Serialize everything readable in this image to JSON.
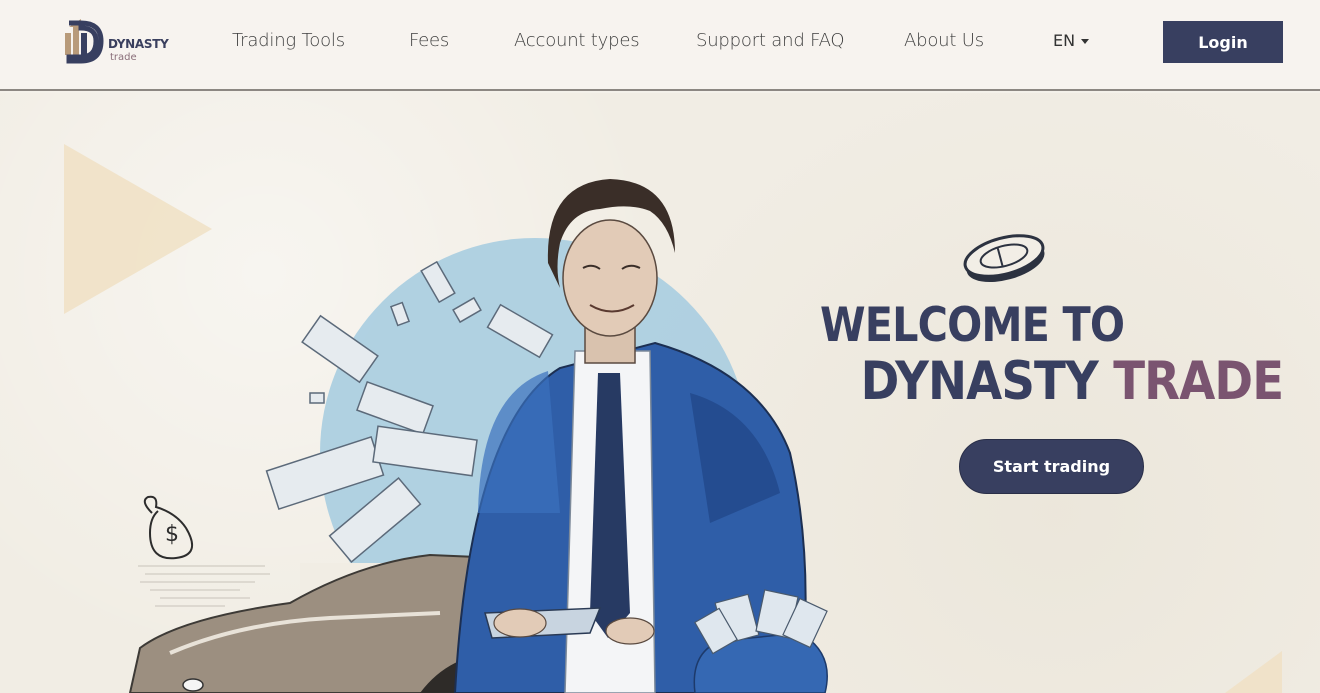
{
  "header": {
    "logo": {
      "name": "DYNASTY",
      "sub": "trade"
    },
    "nav": [
      {
        "label": "Trading Tools"
      },
      {
        "label": "Fees"
      },
      {
        "label": "Account types"
      },
      {
        "label": "Support and FAQ"
      },
      {
        "label": "About Us"
      }
    ],
    "language": "EN",
    "login_label": "Login"
  },
  "hero": {
    "welcome": "WELCOME TO",
    "brand_part1": "DYNASTY",
    "brand_part2": "TRADE",
    "start_label": "Start trading"
  },
  "colors": {
    "primary": "#383f60",
    "accent": "#7a5470",
    "header_bg": "#f7f3ef",
    "hero_bg": "#f1ede4",
    "circle": "#a9cde0",
    "triangle": "#f0e0c4"
  }
}
